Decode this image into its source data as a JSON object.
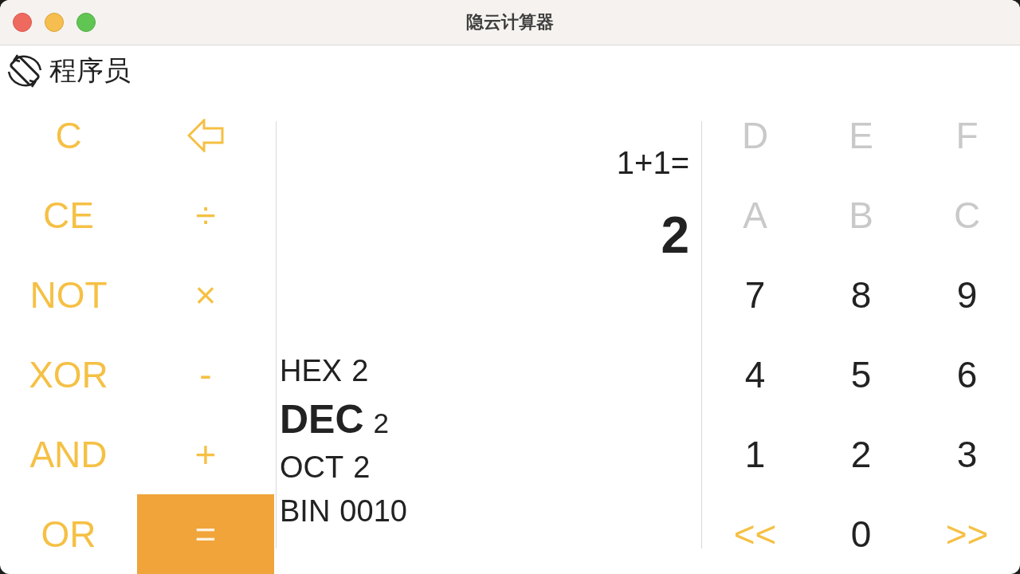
{
  "window": {
    "title": "隐云计算器"
  },
  "mode": {
    "label": "程序员"
  },
  "function_keys": [
    {
      "kind": "text",
      "label": "C",
      "primary": false
    },
    {
      "kind": "backspace",
      "primary": false
    },
    {
      "kind": "text",
      "label": "CE",
      "primary": false
    },
    {
      "kind": "text",
      "label": "÷",
      "primary": false
    },
    {
      "kind": "text",
      "label": "NOT",
      "primary": false
    },
    {
      "kind": "text",
      "label": "×",
      "primary": false
    },
    {
      "kind": "text",
      "label": "XOR",
      "primary": false
    },
    {
      "kind": "text",
      "label": "-",
      "primary": false
    },
    {
      "kind": "text",
      "label": "AND",
      "primary": false
    },
    {
      "kind": "text",
      "label": "+",
      "primary": false
    },
    {
      "kind": "text",
      "label": "OR",
      "primary": false
    },
    {
      "kind": "text",
      "label": "=",
      "primary": true
    }
  ],
  "display": {
    "expression": "1+1=",
    "result": "2",
    "bases": [
      {
        "name": "HEX",
        "value": "2",
        "selected": false
      },
      {
        "name": "DEC",
        "value": "2",
        "selected": true
      },
      {
        "name": "OCT",
        "value": "2",
        "selected": false
      },
      {
        "name": "BIN",
        "value": "0010",
        "selected": false
      }
    ]
  },
  "number_keys": [
    {
      "kind": "digit",
      "label": "D",
      "disabled": true
    },
    {
      "kind": "digit",
      "label": "E",
      "disabled": true
    },
    {
      "kind": "digit",
      "label": "F",
      "disabled": true
    },
    {
      "kind": "digit",
      "label": "A",
      "disabled": true
    },
    {
      "kind": "digit",
      "label": "B",
      "disabled": true
    },
    {
      "kind": "digit",
      "label": "C",
      "disabled": true
    },
    {
      "kind": "digit",
      "label": "7",
      "disabled": false
    },
    {
      "kind": "digit",
      "label": "8",
      "disabled": false
    },
    {
      "kind": "digit",
      "label": "9",
      "disabled": false
    },
    {
      "kind": "digit",
      "label": "4",
      "disabled": false
    },
    {
      "kind": "digit",
      "label": "5",
      "disabled": false
    },
    {
      "kind": "digit",
      "label": "6",
      "disabled": false
    },
    {
      "kind": "digit",
      "label": "1",
      "disabled": false
    },
    {
      "kind": "digit",
      "label": "2",
      "disabled": false
    },
    {
      "kind": "digit",
      "label": "3",
      "disabled": false
    },
    {
      "kind": "shift",
      "label": "<<",
      "disabled": false
    },
    {
      "kind": "digit",
      "label": "0",
      "disabled": false
    },
    {
      "kind": "shift",
      "label": ">>",
      "disabled": false
    }
  ]
}
